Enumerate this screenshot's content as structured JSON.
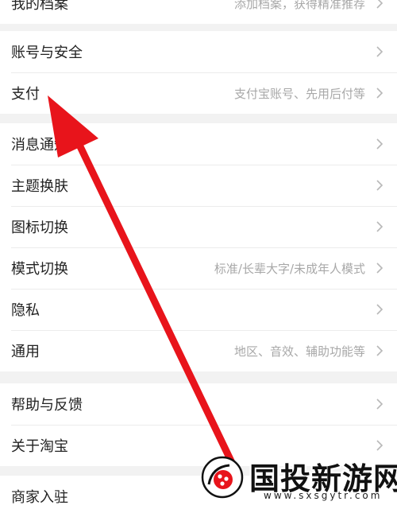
{
  "groups": [
    [
      {
        "label": "我的档案",
        "sub": "添加档案，获得精准推荐"
      }
    ],
    [
      {
        "label": "账号与安全",
        "sub": ""
      },
      {
        "label": "支付",
        "sub": "支付宝账号、先用后付等"
      }
    ],
    [
      {
        "label": "消息通知",
        "sub": ""
      },
      {
        "label": "主题换肤",
        "sub": ""
      },
      {
        "label": "图标切换",
        "sub": ""
      },
      {
        "label": "模式切换",
        "sub": "标准/长辈大字/未成年人模式"
      },
      {
        "label": "隐私",
        "sub": ""
      },
      {
        "label": "通用",
        "sub": "地区、音效、辅助功能等"
      }
    ],
    [
      {
        "label": "帮助与反馈",
        "sub": ""
      },
      {
        "label": "关于淘宝",
        "sub": ""
      }
    ],
    [
      {
        "label": "商家入驻",
        "sub": ""
      }
    ]
  ],
  "watermark": {
    "name": "国投新游网",
    "url": "www.sxsgytr.com"
  },
  "colors": {
    "arrow": "#e8141b",
    "chevron": "#b8b8b8",
    "subtext": "#a8a8a8"
  }
}
